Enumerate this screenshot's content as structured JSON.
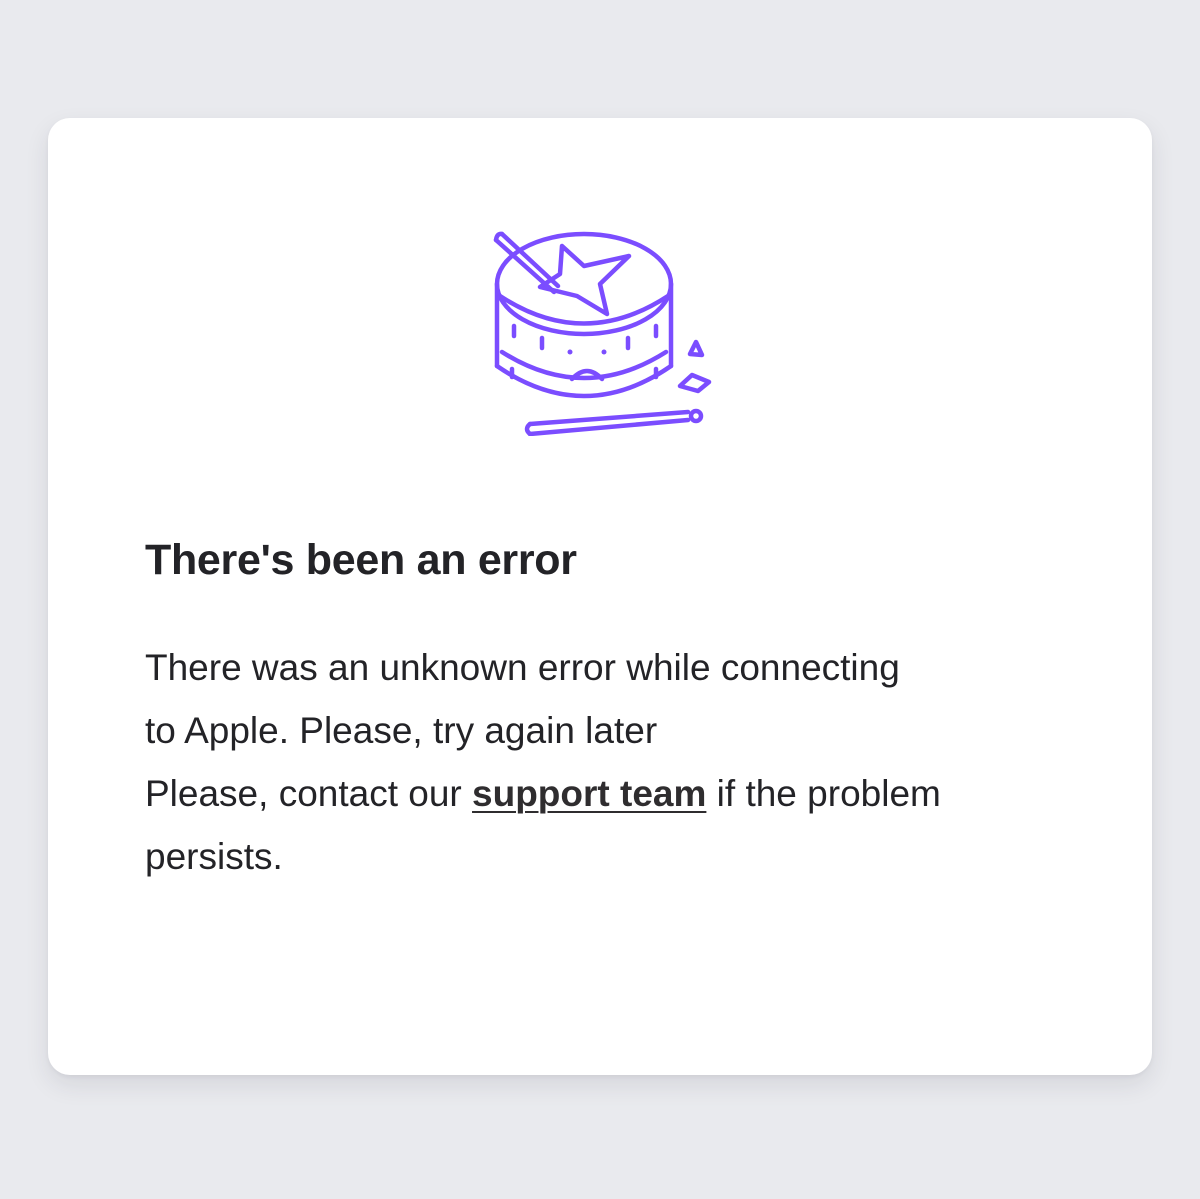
{
  "error": {
    "title": "There's been an error",
    "message_line1": "There was an unknown error while connecting",
    "message_line2": "to Apple. Please, try again later",
    "contact_prefix": "Please, contact our ",
    "support_link_label": "support team",
    "contact_suffix_line1": " if the problem",
    "contact_suffix_line2": "persists."
  },
  "illustration": {
    "icon": "sad-broken-drum-icon",
    "accent_color": "#7b4dff"
  },
  "colors": {
    "background": "#e9eaee",
    "card": "#ffffff",
    "text": "#232327"
  }
}
